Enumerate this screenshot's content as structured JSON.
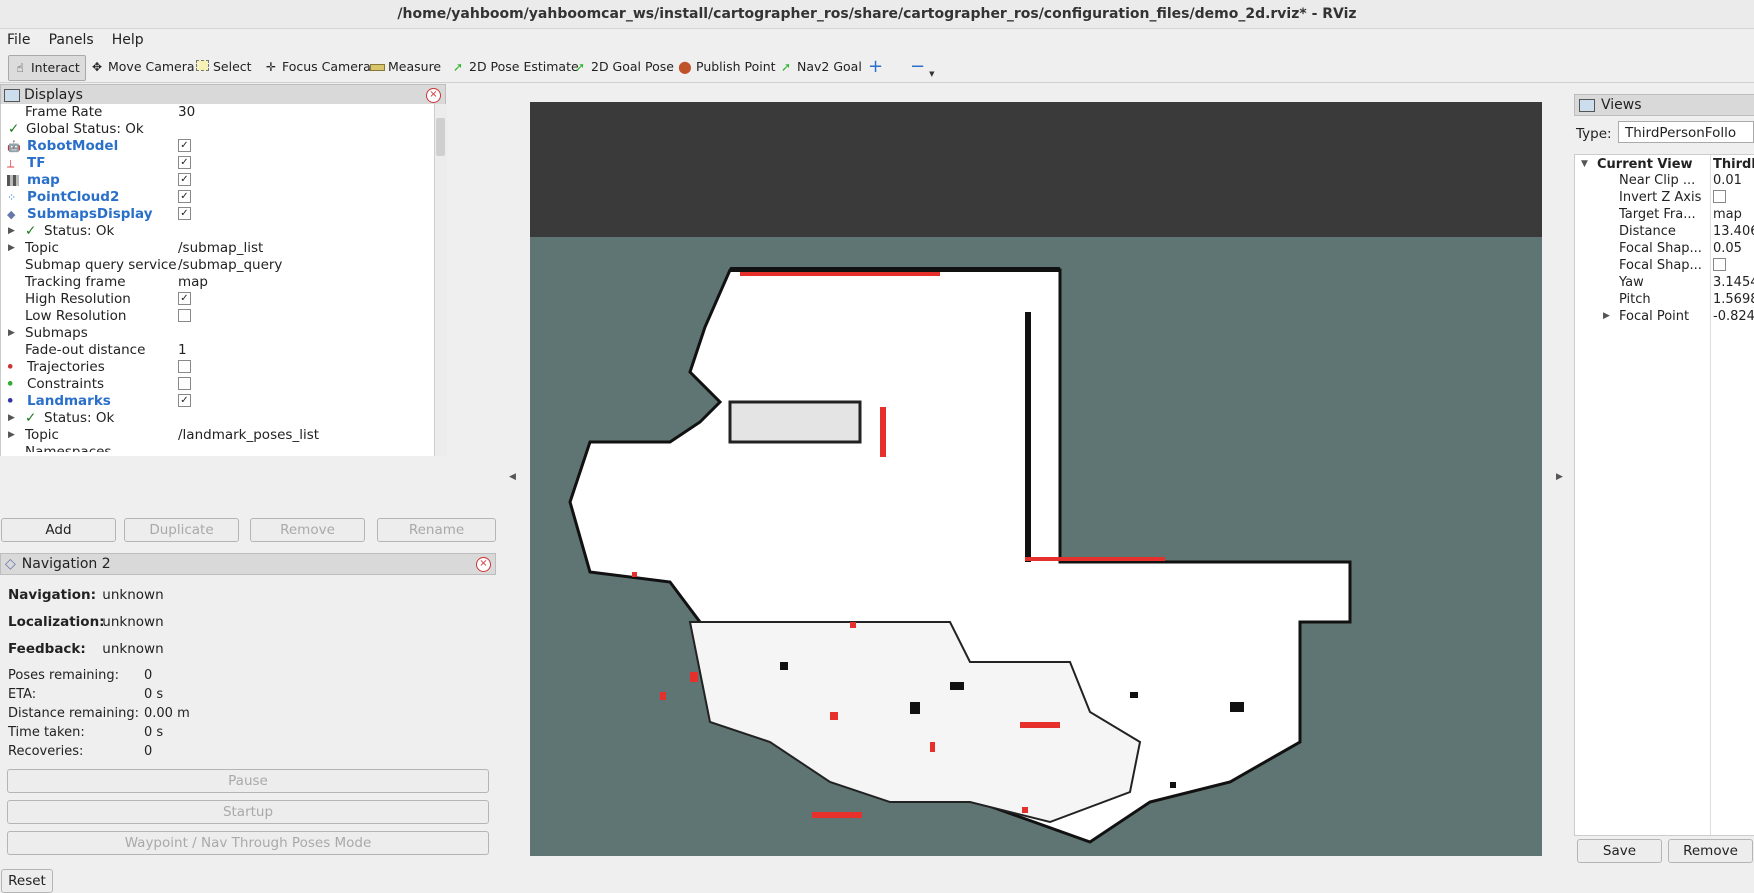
{
  "window": {
    "title": "/home/yahboom/yahboomcar_ws/install/cartographer_ros/share/cartographer_ros/configuration_files/demo_2d.rviz* - RViz"
  },
  "menu": {
    "file": "File",
    "panels": "Panels",
    "help": "Help"
  },
  "toolbar": {
    "interact": "Interact",
    "move_camera": "Move Camera",
    "select": "Select",
    "focus_camera": "Focus Camera",
    "measure": "Measure",
    "pose_estimate": "2D Pose Estimate",
    "goal_pose": "2D Goal Pose",
    "publish_point": "Publish Point",
    "nav2_goal": "Nav2 Goal"
  },
  "displays": {
    "title": "Displays",
    "rows": [
      {
        "name": "Frame Rate",
        "value": "30"
      },
      {
        "name": "Global Status: Ok",
        "value": ""
      },
      {
        "name": "RobotModel",
        "value": "✓"
      },
      {
        "name": "TF",
        "value": "✓"
      },
      {
        "name": "map",
        "value": "✓"
      },
      {
        "name": "PointCloud2",
        "value": "✓"
      },
      {
        "name": "SubmapsDisplay",
        "value": "✓"
      },
      {
        "name": "Status: Ok",
        "value": ""
      },
      {
        "name": "Topic",
        "value": "/submap_list"
      },
      {
        "name": "Submap query service",
        "value": "/submap_query"
      },
      {
        "name": "Tracking frame",
        "value": "map"
      },
      {
        "name": "High Resolution",
        "value": "✓"
      },
      {
        "name": "Low Resolution",
        "value": ""
      },
      {
        "name": "Submaps",
        "value": ""
      },
      {
        "name": "Fade-out distance",
        "value": "1"
      },
      {
        "name": "Trajectories",
        "value": ""
      },
      {
        "name": "Constraints",
        "value": ""
      },
      {
        "name": "Landmarks",
        "value": "✓"
      },
      {
        "name": "Status: Ok",
        "value": ""
      },
      {
        "name": "Topic",
        "value": "/landmark_poses_list"
      },
      {
        "name": "Namespaces",
        "value": ""
      }
    ],
    "buttons": {
      "add": "Add",
      "duplicate": "Duplicate",
      "remove": "Remove",
      "rename": "Rename"
    }
  },
  "nav2": {
    "title": "Navigation 2",
    "navigation_label": "Navigation:",
    "navigation": "unknown",
    "localization_label": "Localization:",
    "localization": "unknown",
    "feedback_label": "Feedback:",
    "feedback": "unknown",
    "poses_label": "Poses remaining:",
    "poses": "0",
    "eta_label": "ETA:",
    "eta": "0 s",
    "distance_label": "Distance remaining:",
    "distance": "0.00 m",
    "time_label": "Time taken:",
    "time": "0 s",
    "recoveries_label": "Recoveries:",
    "recoveries": "0",
    "pause": "Pause",
    "startup": "Startup",
    "waypoint": "Waypoint / Nav Through Poses Mode",
    "reset": "Reset"
  },
  "views": {
    "title": "Views",
    "type_label": "Type:",
    "type_value": "ThirdPersonFollo",
    "header_name": "Current View",
    "header_value": "ThirdP",
    "rows": [
      {
        "name": "Near Clip ...",
        "value": "0.01"
      },
      {
        "name": "Invert Z Axis",
        "value": ""
      },
      {
        "name": "Target Fra...",
        "value": "map"
      },
      {
        "name": "Distance",
        "value": "13.406"
      },
      {
        "name": "Focal Shap...",
        "value": "0.05"
      },
      {
        "name": "Focal Shap...",
        "value": ""
      },
      {
        "name": "Yaw",
        "value": "3.1454"
      },
      {
        "name": "Pitch",
        "value": "1.5698"
      },
      {
        "name": "Focal Point",
        "value": "-0.824"
      }
    ],
    "save": "Save",
    "remove": "Remove"
  }
}
